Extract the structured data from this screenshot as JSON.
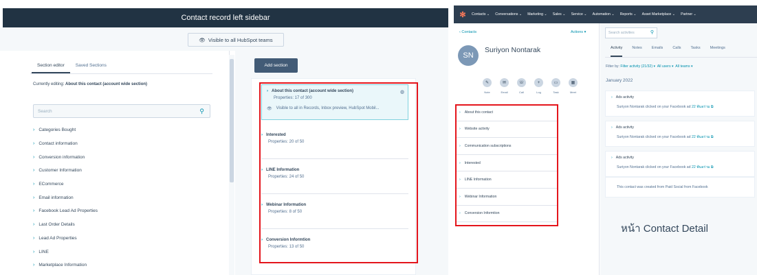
{
  "left": {
    "header_title": "Contact record left sidebar",
    "visible_button": "Visible to all HubSpot teams",
    "tabs": [
      "Section editor",
      "Saved Sections"
    ],
    "editing_prefix": "Currently editing:",
    "editing_value": "About this contact (account wide section)",
    "search_placeholder": "Search",
    "categories": [
      "Categories Bought",
      "Contact information",
      "Conversion information",
      "Customer Information",
      "ECommerce",
      "Email information",
      "Facebook Lead Ad Properties",
      "Last Order Details",
      "Lead Ad Properties",
      "LINE",
      "Marketplace Information"
    ],
    "add_section_label": "Add section",
    "sections": [
      {
        "title": "About this contact (account wide section)",
        "props": "Properties: 17 of 300",
        "visibility": "Visible to all in Records, Inbox preview, HubSpot Mobil..."
      },
      {
        "title": "Interested",
        "props": "Properties: 20 of 50"
      },
      {
        "title": "LINE Information",
        "props": "Properties: 24 of 50"
      },
      {
        "title": "Webinar Information",
        "props": "Properties: 8 of 50"
      },
      {
        "title": "Conversion Informtion",
        "props": "Properties: 13 of 50"
      }
    ]
  },
  "right": {
    "nav": [
      "Contacts ⌄",
      "Conversations ⌄",
      "Marketing ⌄",
      "Sales ⌄",
      "Service ⌄",
      "Automation ⌄",
      "Reports ⌄",
      "Asset Marketplace ⌄",
      "Partner ⌄"
    ],
    "back_link": "‹ Contacts",
    "actions_label": "Actions ▾",
    "avatar_initials": "SN",
    "contact_name": "Suriyon Nontarak",
    "action_buttons": [
      "Note",
      "Email",
      "Call",
      "Log",
      "Task",
      "Meet"
    ],
    "sections": [
      "About this contact",
      "Website activity",
      "Communication subscriptions",
      "Interested",
      "LINE Information",
      "Webinar Information",
      "Conversion Informtion"
    ],
    "activity_search_placeholder": "Search activities",
    "activity_tabs": [
      "Activity",
      "Notes",
      "Emails",
      "Calls",
      "Tasks",
      "Meetings"
    ],
    "filter_prefix": "Filter by:",
    "filter_activity": "Filter activity (21/32) ▾",
    "filter_users": "All users ▾",
    "filter_teams": "All teams ▾",
    "month": "January 2022",
    "activities": [
      {
        "title": "Ads activity",
        "desc": "Suriyon Nontarak clicked on your Facebook ad",
        "link": "22 พ้นอร่าม ⧉"
      },
      {
        "title": "Ads activity",
        "desc": "Suriyon Nontarak clicked on your Facebook ad",
        "link": "22 พ้นอร่าม ⧉"
      },
      {
        "title": "Ads activity",
        "desc": "Suriyon Nontarak clicked on your Facebook ad",
        "link": "22 พ้นอร่าม ⧉"
      }
    ],
    "created_note": "This contact was created from Paid Social from Facebook",
    "caption": "หน้า Contact Detail"
  },
  "colors": {
    "highlight_border": "#e4141b",
    "nav_bg": "#2d3e50",
    "header_bg": "#213343",
    "accent": "#0091ae"
  }
}
